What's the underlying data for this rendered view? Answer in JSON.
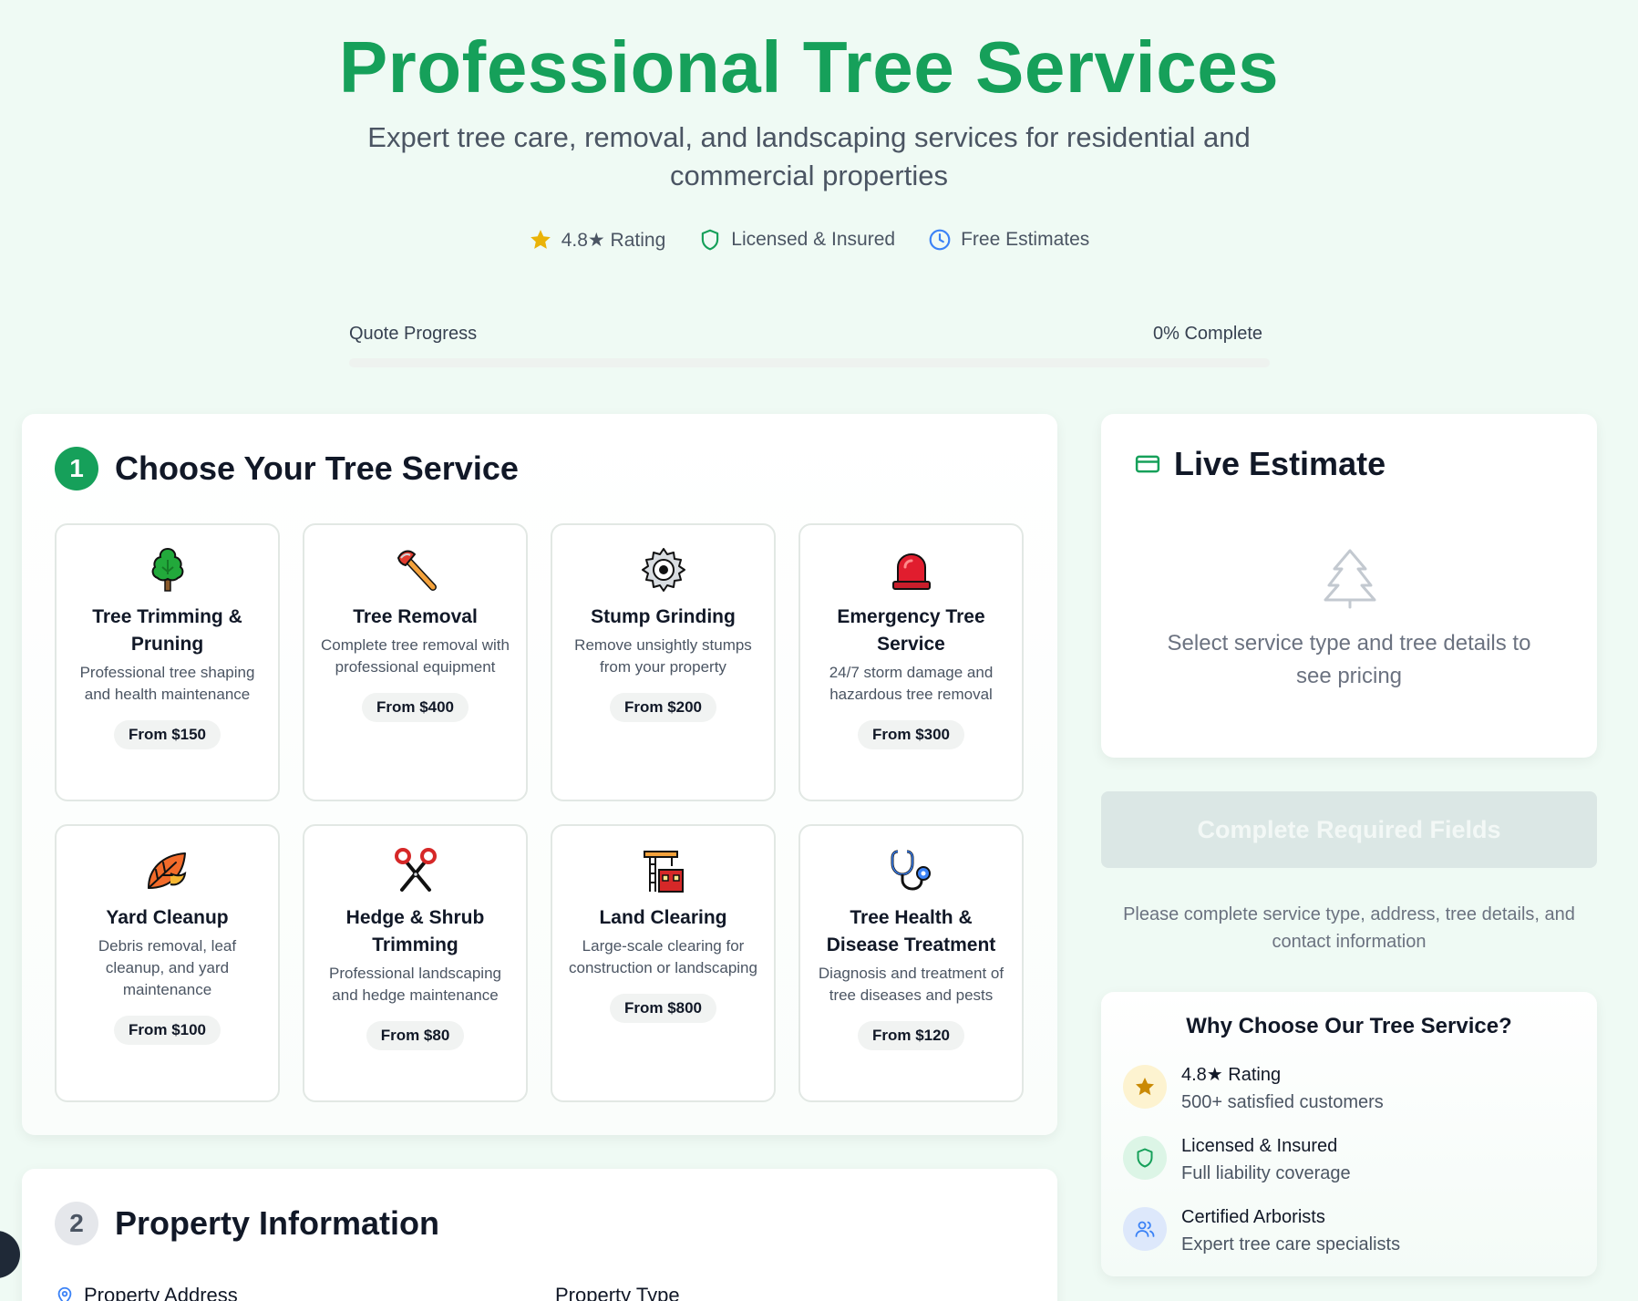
{
  "hero": {
    "title": "Professional Tree Services",
    "subtitle": "Expert tree care, removal, and landscaping services for residential and commercial properties",
    "badges": [
      {
        "icon": "star-icon",
        "label": "4.8★ Rating"
      },
      {
        "icon": "shield-icon",
        "label": "Licensed & Insured"
      },
      {
        "icon": "clock-icon",
        "label": "Free Estimates"
      }
    ]
  },
  "progress": {
    "label": "Quote Progress",
    "value_text": "0% Complete",
    "percent": 0
  },
  "services_section": {
    "step": "1",
    "title": "Choose Your Tree Service",
    "services": [
      {
        "icon": "tree-icon",
        "name": "Tree Trimming & Pruning",
        "desc": "Professional tree shaping and health maintenance",
        "price": "From $150"
      },
      {
        "icon": "axe-icon",
        "name": "Tree Removal",
        "desc": "Complete tree removal with professional equipment",
        "price": "From $400"
      },
      {
        "icon": "gear-icon",
        "name": "Stump Grinding",
        "desc": "Remove unsightly stumps from your property",
        "price": "From $200"
      },
      {
        "icon": "siren-icon",
        "name": "Emergency Tree Service",
        "desc": "24/7 storm damage and hazardous tree removal",
        "price": "From $300"
      },
      {
        "icon": "leaf-icon",
        "name": "Yard Cleanup",
        "desc": "Debris removal, leaf cleanup, and yard maintenance",
        "price": "From $100"
      },
      {
        "icon": "scissors-icon",
        "name": "Hedge & Shrub Trimming",
        "desc": "Professional landscaping and hedge maintenance",
        "price": "From $80"
      },
      {
        "icon": "construction-icon",
        "name": "Land Clearing",
        "desc": "Large-scale clearing for construction or landscaping",
        "price": "From $800"
      },
      {
        "icon": "stethoscope-icon",
        "name": "Tree Health & Disease Treatment",
        "desc": "Diagnosis and treatment of tree diseases and pests",
        "price": "From $120"
      }
    ]
  },
  "property_section": {
    "step": "2",
    "title": "Property Information",
    "address_label": "Property Address",
    "type_label": "Property Type"
  },
  "estimate": {
    "title": "Live Estimate",
    "empty_text": "Select service type and tree details to see pricing"
  },
  "submit": {
    "label": "Complete Required Fields",
    "note": "Please complete service type, address, tree details, and contact information"
  },
  "why": {
    "title": "Why Choose Our Tree Service?",
    "items": [
      {
        "icon": "star-icon",
        "title": "4.8★ Rating",
        "sub": "500+ satisfied customers"
      },
      {
        "icon": "shield-icon",
        "title": "Licensed & Insured",
        "sub": "Full liability coverage"
      },
      {
        "icon": "users-icon",
        "title": "Certified Arborists",
        "sub": "Expert tree care specialists"
      }
    ]
  },
  "colors": {
    "brand_green": "#16a05a",
    "star_yellow": "#eab308",
    "clock_blue": "#3b82f6"
  }
}
